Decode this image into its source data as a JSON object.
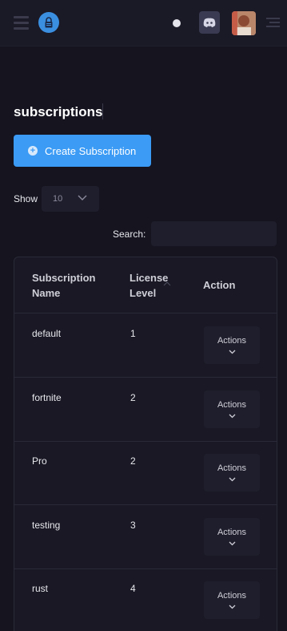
{
  "header": {
    "menu_icon": "hamburger-icon",
    "logo_icon": "lock-logo-icon",
    "status_icon": "status-dot-icon",
    "discord_icon": "discord-icon",
    "avatar_icon": "user-avatar",
    "right_menu_icon": "sidebar-menu-icon"
  },
  "page": {
    "title": "subscriptions",
    "create_button_label": "Create Subscription"
  },
  "controls": {
    "show_label": "Show",
    "show_value": "10",
    "search_label": "Search:",
    "search_value": ""
  },
  "table": {
    "columns": {
      "name_line1": "Subscription",
      "name_line2": "Name",
      "level_line1": "License",
      "level_line2": "Level",
      "action": "Action"
    },
    "action_button_label": "Actions",
    "rows": [
      {
        "name": "default",
        "level": "1"
      },
      {
        "name": "fortnite",
        "level": "2"
      },
      {
        "name": "Pro",
        "level": "2"
      },
      {
        "name": "testing",
        "level": "3"
      },
      {
        "name": "rust",
        "level": "4"
      }
    ]
  },
  "colors": {
    "background": "#15141f",
    "accent": "#3b9bf5",
    "surface": "#1f1e2c"
  }
}
